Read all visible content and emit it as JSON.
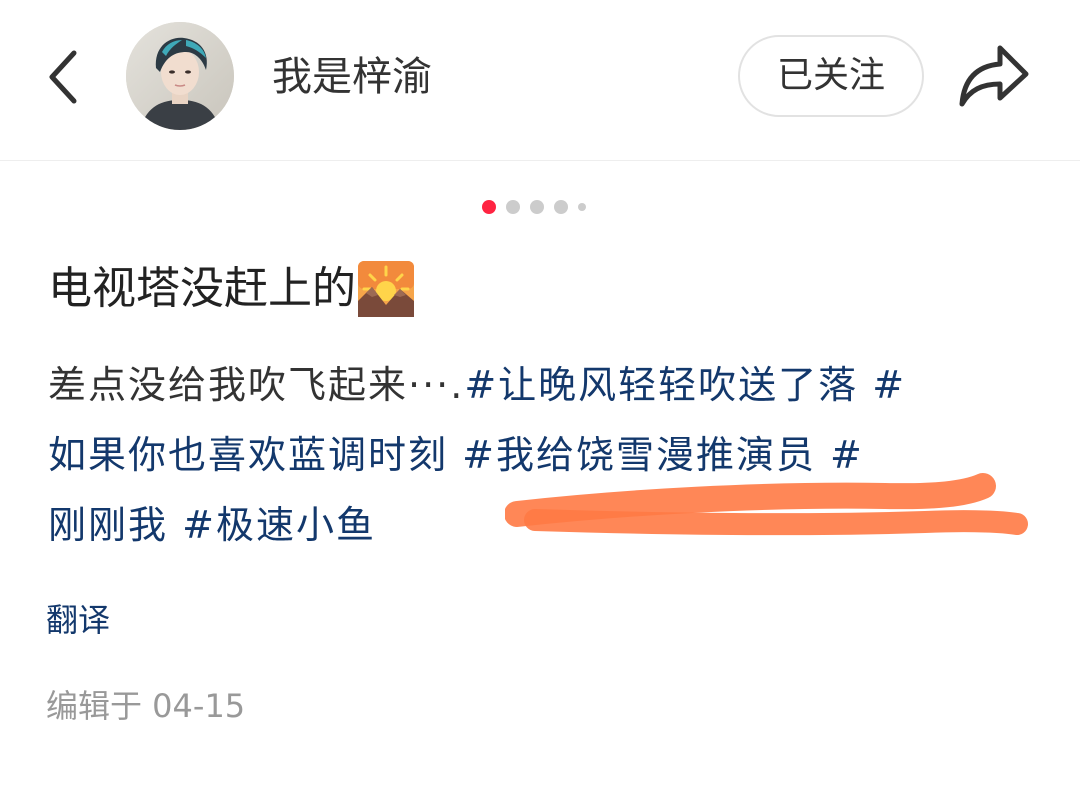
{
  "header": {
    "back_icon": "chevron-left-icon",
    "author_name": "我是梓渝",
    "follow_label": "已关注",
    "share_icon": "share-arrow-icon"
  },
  "carousel": {
    "total_dots": 5,
    "active_index": 0
  },
  "note": {
    "title": "电视塔没赶上的",
    "title_emoji": "sunrise-over-mountains-icon",
    "body_text": "差点没给我吹飞起来···.",
    "hashtags": [
      "#让晚风轻轻吹送了落 #",
      "如果你也喜欢蓝调时刻",
      "#我给饶雪漫推演员 #",
      "刚刚我",
      "#极速小鱼"
    ],
    "translate_label": "翻译",
    "edit_info": "编辑于 04-15"
  },
  "colors": {
    "accent": "#ff2442",
    "hashtag": "#13386c",
    "scribble": "#ff7a45",
    "muted": "#999999"
  }
}
